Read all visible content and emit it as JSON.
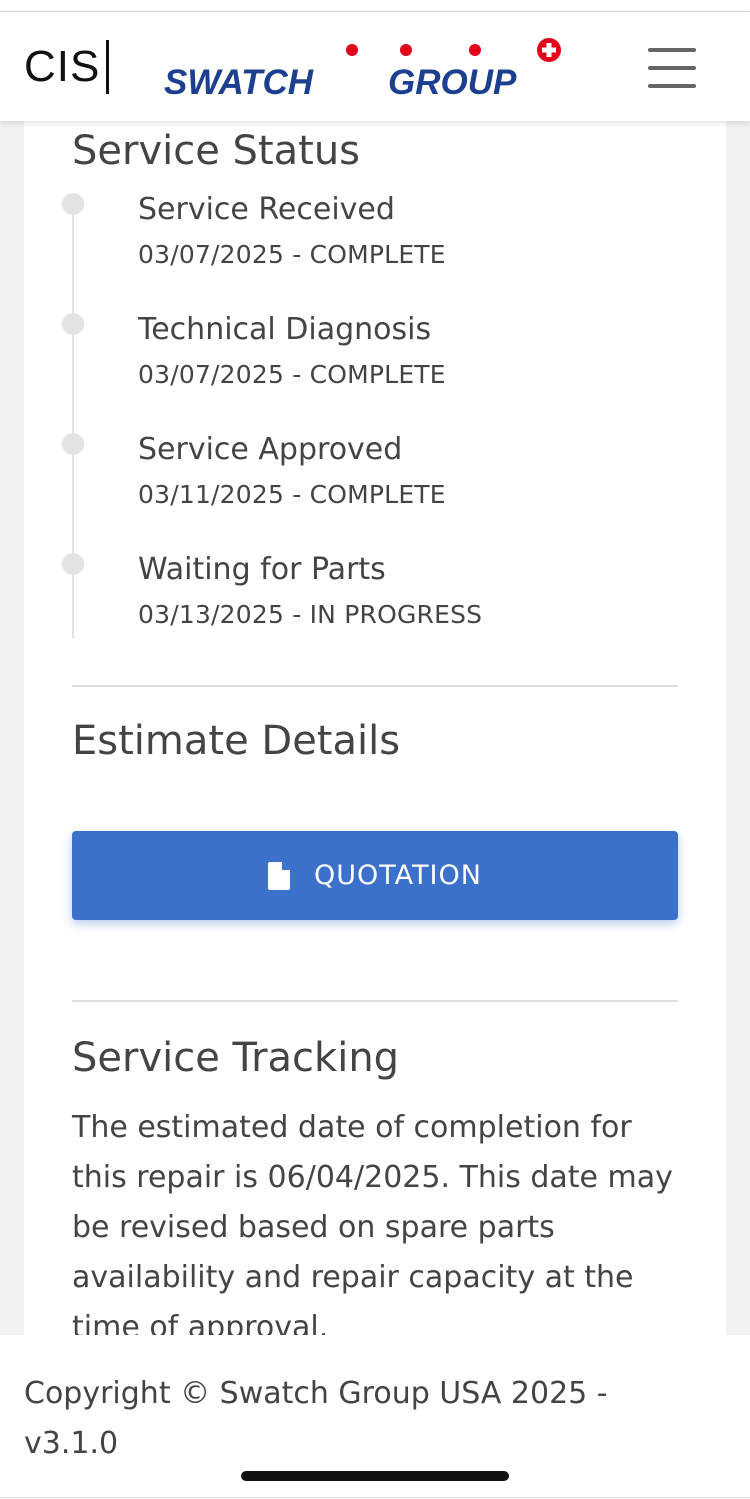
{
  "header": {
    "cis_logo": "CIS",
    "brand_left": "SWATCH",
    "brand_right": "GROUP",
    "brand_color": "#1d3f8f",
    "brand_dot_color": "#e2001a"
  },
  "service_status": {
    "title": "Service Status",
    "steps": [
      {
        "label": "Service Received",
        "status": "03/07/2025 - COMPLETE"
      },
      {
        "label": "Technical Diagnosis",
        "status": "03/07/2025 - COMPLETE"
      },
      {
        "label": "Service Approved",
        "status": "03/11/2025 - COMPLETE"
      },
      {
        "label": "Waiting for Parts",
        "status": "03/13/2025 - IN PROGRESS"
      }
    ]
  },
  "estimate": {
    "title": "Estimate Details",
    "button_label": "QUOTATION",
    "button_icon": "document-icon",
    "button_color": "#3b70cb"
  },
  "tracking": {
    "title": "Service Tracking",
    "text": "The estimated date of completion for this repair is 06/04/2025. This date may be revised based on spare parts availability and repair capacity at the time of approval."
  },
  "footer": {
    "copyright": "Copyright © Swatch Group USA 2025 - v3.1.0"
  }
}
